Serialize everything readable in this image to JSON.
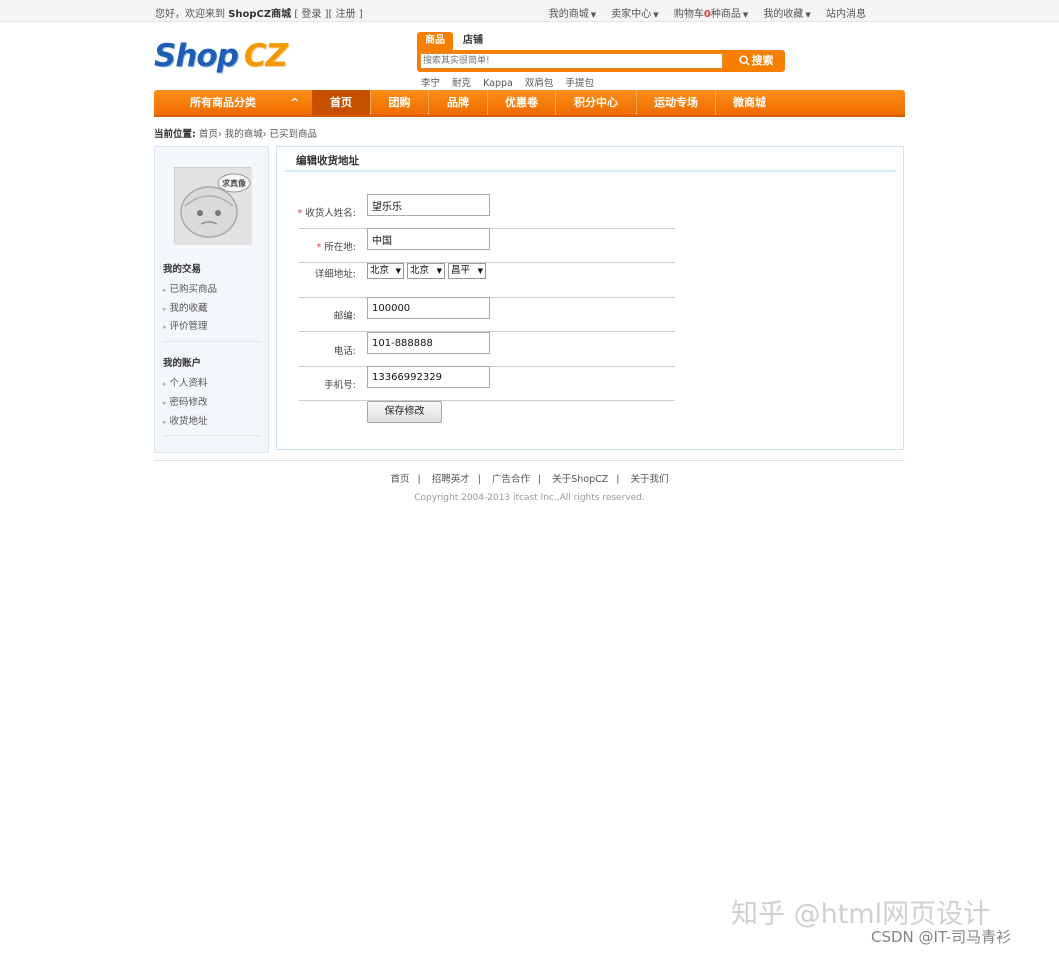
{
  "topbar": {
    "welcome_prefix": "您好，欢迎来到",
    "site_name": "ShopCZ商城",
    "login": "[ 登录 ]",
    "register": "[ 注册 ]",
    "links": [
      "我的商城",
      "卖家中心",
      "购物车",
      "我的收藏",
      "站内消息"
    ],
    "cart_count": "0",
    "cart_suffix": "种商品"
  },
  "logo": {
    "part1": "Shop",
    "part2": "CZ"
  },
  "search": {
    "tabs": [
      "商品",
      "店铺"
    ],
    "placeholder": "搜索其实很简单!",
    "button": "搜索",
    "hot_words": [
      "李宁",
      "耐克",
      "Kappa",
      "双肩包",
      "手提包"
    ]
  },
  "nav": {
    "category": "所有商品分类",
    "items": [
      "首页",
      "团购",
      "品牌",
      "优惠卷",
      "积分中心",
      "运动专场",
      "微商城"
    ]
  },
  "breadcrumb": {
    "label": "当前位置:",
    "items": [
      "首页",
      "我的商城",
      "已买到商品"
    ]
  },
  "sidebar": {
    "avatar_text": "求真像",
    "section1": "我的交易",
    "section1_items": [
      "已购买商品",
      "我的收藏",
      "评价管理"
    ],
    "section2": "我的账户",
    "section2_items": [
      "个人资料",
      "密码修改",
      "收货地址"
    ]
  },
  "form": {
    "title": "编辑收货地址",
    "name_label": "收货人姓名:",
    "name_value": "望乐乐",
    "location_label": "所在地:",
    "location_value": "中国",
    "address_label": "详细地址:",
    "address_selects": [
      "北京",
      "北京",
      "昌平"
    ],
    "zip_label": "邮编:",
    "zip_value": "100000",
    "phone_label": "电话:",
    "phone_value": "101-888888",
    "mobile_label": "手机号:",
    "mobile_value": "13366992329",
    "save": "保存修改"
  },
  "footer": {
    "links": [
      "首页",
      "招聘英才",
      "广告合作",
      "关于ShopCZ",
      "关于我们"
    ],
    "copyright": "Copyright 2004-2013 itcast Inc.,All rights reserved."
  },
  "watermark": {
    "line1": "知乎 @html网页设计",
    "line2": "CSDN @IT-司马青衫"
  },
  "colors": {
    "accent": "#f77f00",
    "brand_blue": "#1d5fb4",
    "required": "#e4393c"
  }
}
